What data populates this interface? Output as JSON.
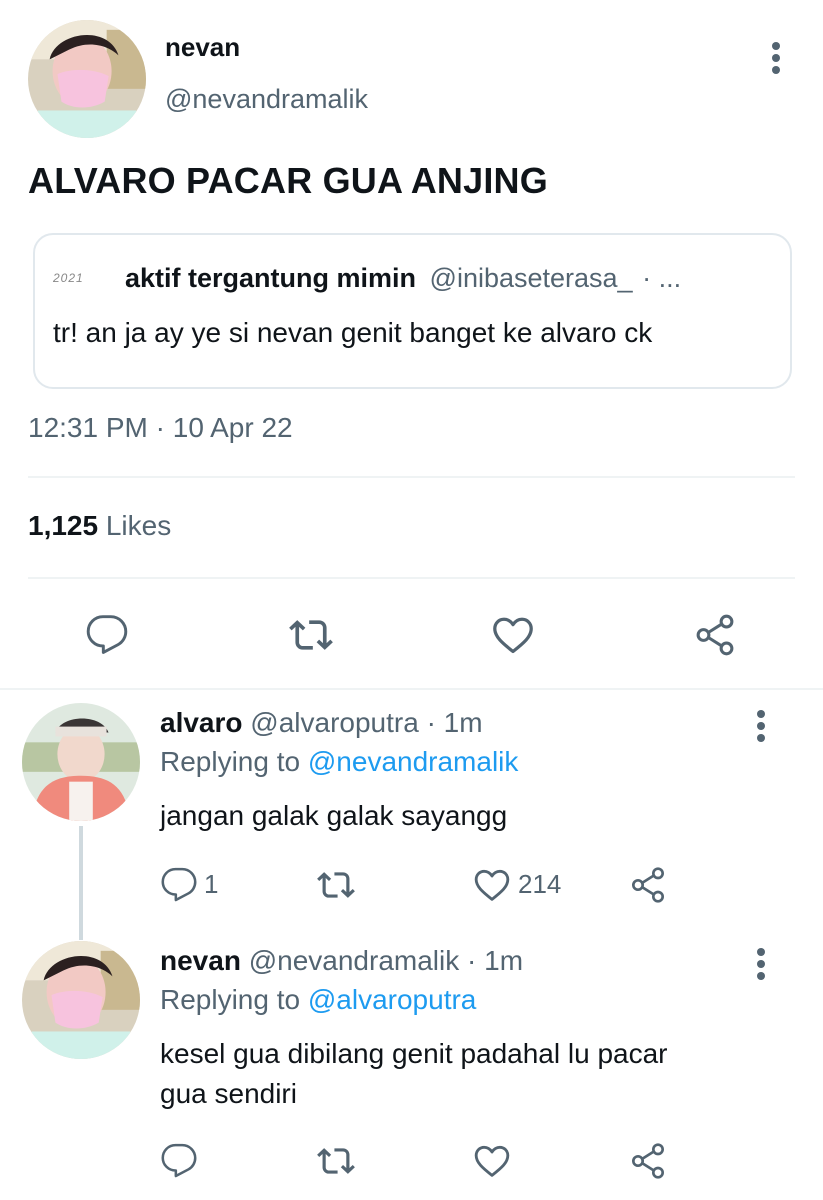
{
  "main_tweet": {
    "display_name": "nevan",
    "handle": "@nevandramalik",
    "text": "ALVARO PACAR GUA ANJING",
    "quoted": {
      "logo_text": "2021",
      "display_name": "aktif tergantung mimin",
      "handle": "@inibaseterasa_",
      "ellipsis": "· ...",
      "text": "tr! an ja ay ye si nevan genit banget ke alvaro ck"
    },
    "time": "12:31 PM",
    "separator": "·",
    "date": "10 Apr 22",
    "likes_count": "1,125",
    "likes_label": "Likes"
  },
  "replies": [
    {
      "display_name": "alvaro",
      "handle": "@alvaroputra",
      "meta": "· 1m",
      "replying_prefix": "Replying to",
      "replying_to": "@nevandramalik",
      "text": "jangan galak galak sayangg",
      "reply_count": "1",
      "retweet_count": "",
      "like_count": "214"
    },
    {
      "display_name": "nevan",
      "handle": "@nevandramalik",
      "meta": "· 1m",
      "replying_prefix": "Replying to",
      "replying_to": "@alvaroputra",
      "text_line1": "kesel gua dibilang genit padahal lu pacar",
      "text_line2": "gua sendiri",
      "reply_count": "",
      "retweet_count": "",
      "like_count": ""
    }
  ],
  "icons": [
    "more-vertical-icon",
    "reply-icon",
    "retweet-icon",
    "like-icon",
    "share-icon"
  ],
  "colors": {
    "text": "#0f1419",
    "muted": "#536471",
    "link": "#1d9bf0",
    "divider": "#eff3f4"
  }
}
